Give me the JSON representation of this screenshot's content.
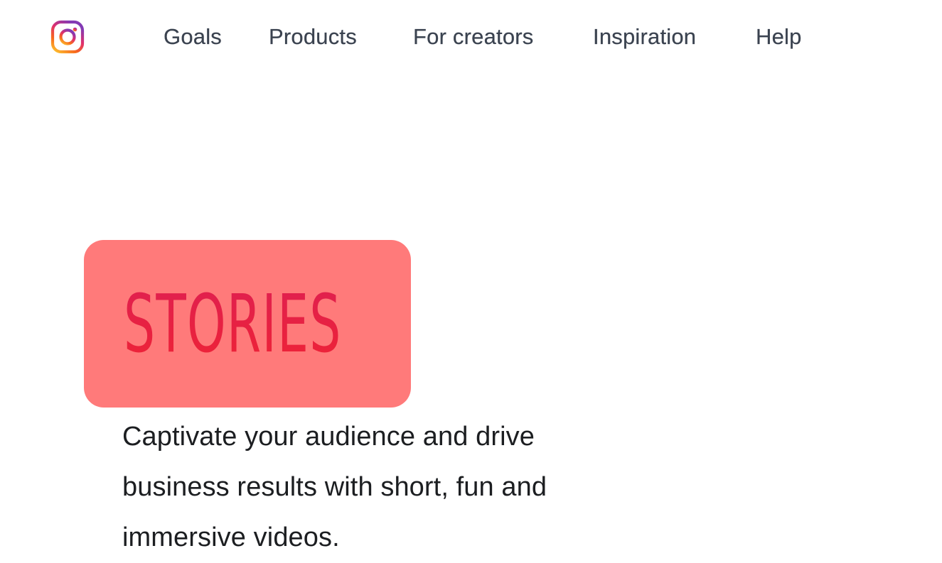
{
  "header": {
    "logo_icon": "instagram-logo-icon",
    "nav": [
      {
        "label": "Goals"
      },
      {
        "label": "Products"
      },
      {
        "label": "For creators"
      },
      {
        "label": "Inspiration"
      },
      {
        "label": "Help"
      }
    ]
  },
  "hero": {
    "badge_label": "STORIES",
    "badge_bg_color": "#ff7a7a",
    "badge_text_color": "#e8203f",
    "description": "Captivate your audience and drive business results with short, fun and immersive videos."
  }
}
